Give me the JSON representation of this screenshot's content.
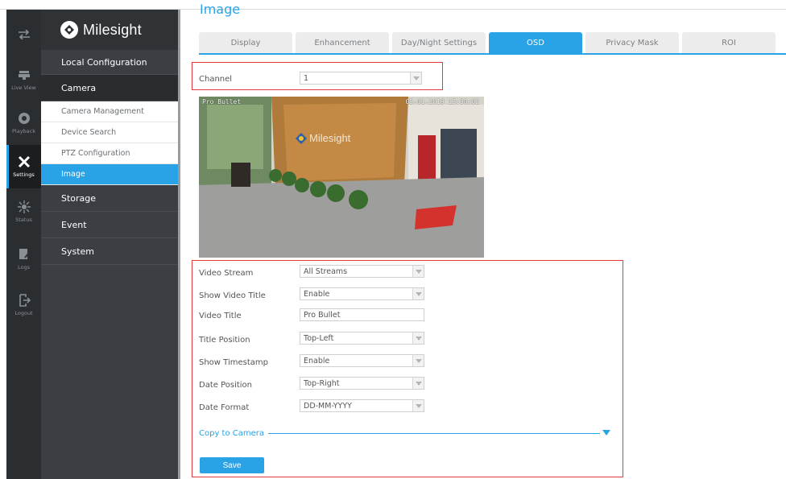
{
  "rail": [
    {
      "label": "",
      "icon": "swap-arrows-icon"
    },
    {
      "label": "Live View",
      "icon": "live-view-icon"
    },
    {
      "label": "Playback",
      "icon": "playback-icon"
    },
    {
      "label": "Settings",
      "icon": "settings-icon"
    },
    {
      "label": "Status",
      "icon": "status-icon"
    },
    {
      "label": "Logs",
      "icon": "logs-icon"
    },
    {
      "label": "Logout",
      "icon": "logout-icon"
    }
  ],
  "brand": "Milesight",
  "nav": {
    "local_configuration": "Local Configuration",
    "camera": "Camera",
    "camera_items": [
      "Camera Management",
      "Device Search",
      "PTZ Configuration",
      "Image"
    ],
    "storage": "Storage",
    "event": "Event",
    "system": "System"
  },
  "page_title": "Image",
  "tabs": [
    "Display",
    "Enhancement",
    "Day/Night Settings",
    "OSD",
    "Privacy Mask",
    "ROI"
  ],
  "active_tab": "OSD",
  "channel": {
    "label": "Channel",
    "value": "1"
  },
  "preview": {
    "title_overlay": "Pro Bullet",
    "time_overlay": "05-01-2019  15:38:02",
    "wall_logo": "Milesight"
  },
  "form": {
    "video_stream": {
      "label": "Video Stream",
      "value": "All Streams"
    },
    "show_video_title": {
      "label": "Show Video Title",
      "value": "Enable"
    },
    "video_title": {
      "label": "Video Title",
      "value": "Pro Bullet"
    },
    "title_position": {
      "label": "Title Position",
      "value": "Top-Left"
    },
    "show_timestamp": {
      "label": "Show Timestamp",
      "value": "Enable"
    },
    "date_position": {
      "label": "Date Position",
      "value": "Top-Right"
    },
    "date_format": {
      "label": "Date Format",
      "value": "DD-MM-YYYY"
    }
  },
  "copy_to_camera": "Copy to Camera",
  "save": "Save",
  "colors": {
    "accent": "#2aa2e6",
    "highlight_border": "#e03a3a",
    "rail_bg": "#2b2e31",
    "nav_bg": "#3b3f43"
  }
}
